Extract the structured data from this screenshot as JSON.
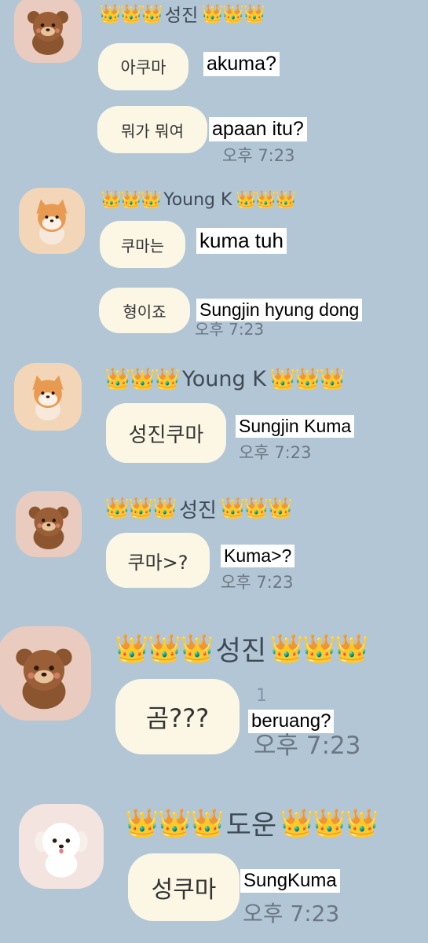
{
  "crowns": "👑👑👑",
  "blocks": [
    {
      "sender": "성진",
      "messages": [
        {
          "korean": "아쿠마",
          "translation": "akuma?"
        },
        {
          "korean": "뭐가 뭐여",
          "translation": "apaan itu?"
        }
      ],
      "time": "오후 7:23"
    },
    {
      "sender": "Young K",
      "messages": [
        {
          "korean": "쿠마는",
          "translation": "kuma tuh"
        },
        {
          "korean": "형이죠",
          "translation": "Sungjin hyung dong"
        }
      ],
      "time": "오후 7:23"
    },
    {
      "sender": "Young K",
      "messages": [
        {
          "korean": "성진쿠마",
          "translation": "Sungjin Kuma"
        }
      ],
      "time": "오후 7:23"
    },
    {
      "sender": "성진",
      "messages": [
        {
          "korean": "쿠마>?",
          "translation": "Kuma>?"
        }
      ],
      "time": "오후 7:23"
    },
    {
      "sender": "성진",
      "messages": [
        {
          "korean": "곰???",
          "translation": "beruang?"
        }
      ],
      "unread": "1",
      "time": "오후 7:23"
    },
    {
      "sender": "도운",
      "messages": [
        {
          "korean": "성쿠마",
          "translation": "SungKuma"
        }
      ],
      "time": "오후 7:23"
    }
  ],
  "avatars": [
    {
      "icon": "bear-avatar-icon",
      "bg": "#e9cbbf"
    },
    {
      "icon": "shiba-avatar-icon",
      "bg": "#f3d6b7"
    },
    {
      "icon": "shiba-avatar-icon",
      "bg": "#f3d6b7"
    },
    {
      "icon": "bear-avatar-icon",
      "bg": "#e9cbbf"
    },
    {
      "icon": "bear-avatar-icon",
      "bg": "#e9cbbf"
    },
    {
      "icon": "puppy-avatar-icon",
      "bg": "#f3e4df"
    }
  ]
}
